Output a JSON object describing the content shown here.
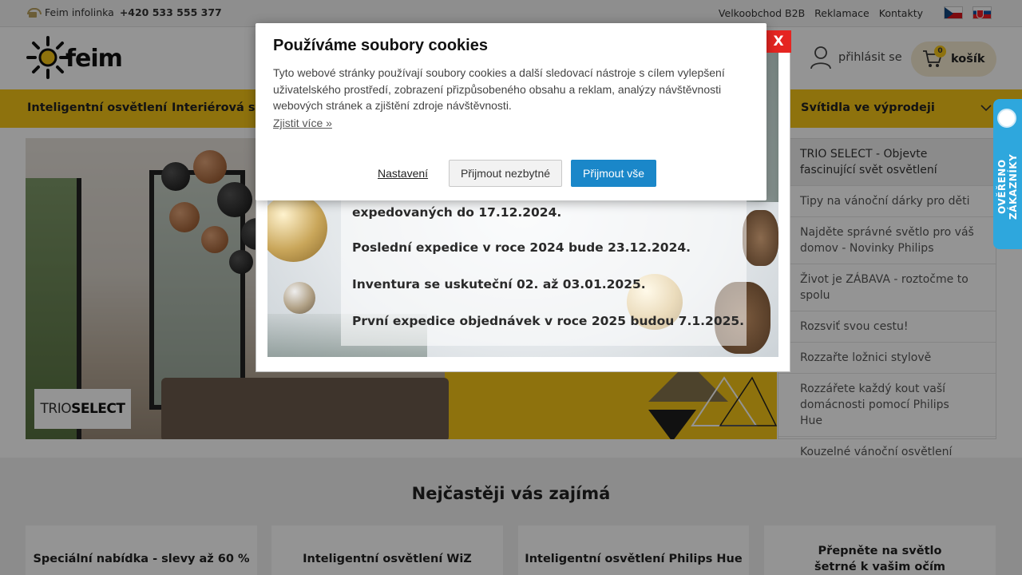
{
  "topbar": {
    "phone_label": "Feim infolinka",
    "phone_number": "+420 533 555 377",
    "links": [
      "Velkoobchod B2B",
      "Reklamace",
      "Kontakty"
    ],
    "flags": [
      "cz-flag-icon",
      "sk-flag-icon"
    ]
  },
  "header": {
    "logo_text": "feim",
    "login_label": "přihlásit se",
    "cart_label": "košík",
    "cart_count": "0"
  },
  "nav": {
    "items": [
      "Inteligentní osvětlení",
      "Interiérová svítidla",
      "Svítidla ve výprodeji"
    ]
  },
  "banner": {
    "badge_prefix": "TRIO",
    "badge_bold": "SELECT"
  },
  "sidebar": {
    "items": [
      "TRIO SELECT - Objevte fascinující svět osvětlení",
      "Tipy na vánoční dárky pro děti",
      "Najděte správné světlo pro váš domov - Novinky Philips",
      "Život je ZÁBAVA - roztočme to spolu",
      "Rozsviť svou cestu!",
      "Rozzařte ložnici stylově",
      "Rozzářete každý kout vaší domácnosti pomocí Philips Hue",
      "Kouzelné vánoční osvětlení"
    ]
  },
  "section": {
    "title": "Nejčastěji vás zajímá",
    "cards": [
      "Speciální nabídka - slevy až 60 %",
      "Inteligentní osvětlení WiZ",
      "Inteligentní osvětlení Philips Hue",
      "Přepněte na světlo šetrné k vašim očím"
    ]
  },
  "verified_tab": {
    "label": "OVĚŘENO ZÁKAZNÍKY"
  },
  "xmas_modal": {
    "close_label": "X",
    "lines": [
      "expedovaných do 17.12.2024.",
      "Poslední expedice v roce 2024 bude 23.12.2024.",
      "Inventura se uskuteční 02. až 03.01.2025.",
      "První expedice objednávek v roce 2025 budou 7.1.2025."
    ]
  },
  "cookie": {
    "title": "Používáme soubory cookies",
    "body": "Tyto webové stránky používají soubory cookies a další sledovací nástroje s cílem vylepšení uživatelského prostředí, zobrazení přizpůsobeného obsahu a reklam, analýzy návštěvnosti webových stránek a zjištění zdroje návštěvnosti.",
    "more_link": "Zjistit více »",
    "settings_label": "Nastavení",
    "accept_necessary_label": "Přijmout nezbytné",
    "accept_all_label": "Přijmout vše"
  },
  "colors": {
    "brand_yellow": "#f5c518",
    "accept_blue": "#1a87c9",
    "close_red": "#e52521",
    "verified_blue": "#2ea7dd"
  }
}
